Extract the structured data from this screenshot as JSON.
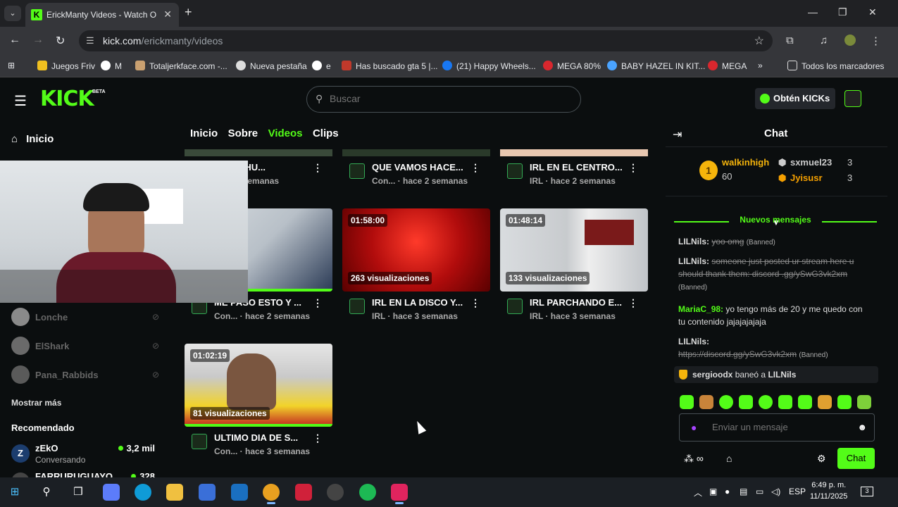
{
  "browser": {
    "tab_title": "ErickManty Videos - Watch On",
    "url_host": "kick.com",
    "url_path": "/erickmanty/videos",
    "bookmarks": [
      "Juegos Friv",
      "M",
      "Totaljerkface.com -...",
      "Nueva pestaña",
      "e",
      "Has buscado gta 5 |...",
      "(21) Happy Wheels...",
      "MEGA 80%",
      "BABY HAZEL IN KIT...",
      "MEGA"
    ],
    "bookmarks_more": "»",
    "all_bookmarks": "Todos los marcadores"
  },
  "kick": {
    "logo": "KICK",
    "beta": "BETA",
    "search_placeholder": "Buscar",
    "get_kicks": "Obtén KICKs"
  },
  "sidebar": {
    "home": "Inicio",
    "following": [
      {
        "name": "Lonche"
      },
      {
        "name": "ElShark"
      },
      {
        "name": "Pana_Rabbids"
      }
    ],
    "show_more": "Mostrar más",
    "recommended_title": "Recomendado",
    "recommended": [
      {
        "initial": "Z",
        "name": "zEkO",
        "category": "Conversando",
        "viewers": "3,2 mil"
      },
      {
        "initial": "F",
        "name": "FARRURUGUAYO",
        "category": "",
        "viewers": "328"
      }
    ]
  },
  "channel_tabs": [
    "Inicio",
    "Sobre",
    "Videos",
    "Clips"
  ],
  "videos": [
    {
      "title": "HUMO HU...",
      "author": "",
      "age": "hace 2 semanas",
      "duration": "",
      "views": ""
    },
    {
      "title": "QUE VAMOS HACE...",
      "author": "Con...",
      "age": "· hace 2 semanas",
      "duration": "",
      "views": ""
    },
    {
      "title": "IRL EN EL CENTRO...",
      "author": "IRL",
      "age": "· hace 2 semanas",
      "duration": "",
      "views": ""
    },
    {
      "title": "ME PASO ESTO Y ...",
      "author": "Con...",
      "age": "· hace 2 semanas",
      "duration": "",
      "views": "ones"
    },
    {
      "title": "IRL EN LA DISCO Y...",
      "author": "IRL",
      "age": "· hace 3 semanas",
      "duration": "01:58:00",
      "views": "263 visualizaciones"
    },
    {
      "title": "IRL PARCHANDO E...",
      "author": "IRL",
      "age": "· hace 3 semanas",
      "duration": "01:48:14",
      "views": "133 visualizaciones"
    },
    {
      "title": "ULTIMO DIA DE S...",
      "author": "Con...",
      "age": "· hace 3 semanas",
      "duration": "01:02:19",
      "views": "81 visualizaciones"
    }
  ],
  "chat": {
    "title": "Chat",
    "leaderboard": {
      "rank": "1",
      "top_name": "walkinhigh",
      "top_points": "60",
      "others": [
        {
          "name": "sxmuel23",
          "value": "3"
        },
        {
          "name": "Jyisusr",
          "value": "3"
        }
      ]
    },
    "new_messages": "Nuevos mensajes",
    "messages": [
      {
        "user": "LILNils:",
        "text": "yoo omg",
        "banned": "(Banned)",
        "color": "#f5f5f5"
      },
      {
        "user": "LILNils:",
        "text": "someone just posted ur stream here u should thank them: discord .gg/ySwG3vk2xm",
        "banned": "(Banned)",
        "color": "#f5f5f5"
      },
      {
        "user": "MariaC_98:",
        "text": "yo tengo más de 20 y me quedo con tu contenido jajajajajaja",
        "banned": "",
        "color": "#53fc18"
      },
      {
        "user": "LILNils:",
        "text": "https://discord.gg/ySwG3vk2xm",
        "banned": "(Banned)",
        "color": "#f5f5f5"
      }
    ],
    "mod_action": {
      "moderator": "sergioodx",
      "verb": "baneó a",
      "target": "LILNils"
    },
    "input_placeholder": "Enviar un mensaje",
    "send": "Chat"
  },
  "taskbar": {
    "lang": "ESP",
    "time": "6:49 p. m.",
    "date": "11/11/2025",
    "notif_count": "3"
  },
  "colors": {
    "kick_green": "#53fc18",
    "gold": "#f5b40b"
  }
}
